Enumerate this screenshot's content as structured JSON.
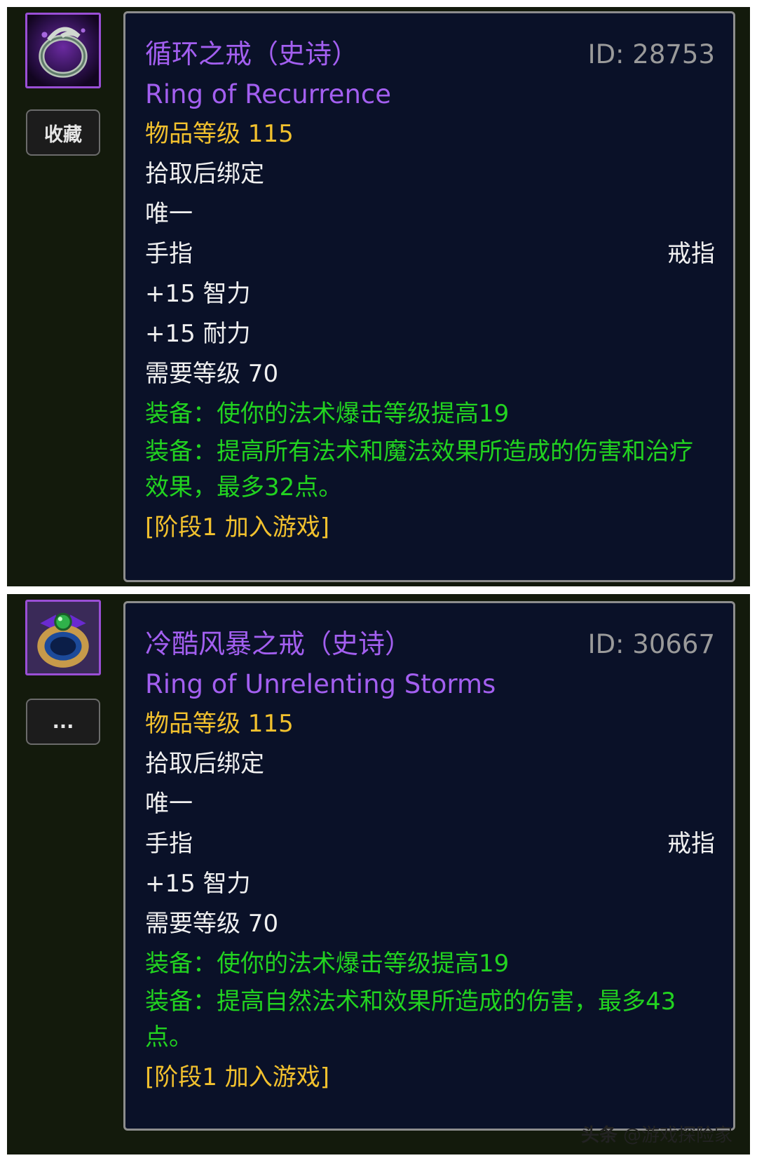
{
  "items": [
    {
      "name_cn": "循环之戒（史诗）",
      "name_en": "Ring of Recurrence",
      "id": "ID: 28753",
      "item_level": "物品等级 115",
      "bind": "拾取后绑定",
      "unique": "唯一",
      "slot": "手指",
      "type": "戒指",
      "stat1": "+15 智力",
      "stat2": "+15 耐力",
      "required_level": "需要等级 70",
      "equip1": "装备：使你的法术爆击等级提高19",
      "equip2": "装备：提高所有法术和魔法效果所造成的伤害和治疗效果，最多32点。",
      "phase": "[阶段1 加入游戏]",
      "button_label": "收藏",
      "icon": "ring-of-recurrence-icon"
    },
    {
      "name_cn": "冷酷风暴之戒（史诗）",
      "name_en": "Ring of Unrelenting Storms",
      "id": "ID: 30667",
      "item_level": "物品等级 115",
      "bind": "拾取后绑定",
      "unique": "唯一",
      "slot": "手指",
      "type": "戒指",
      "stat1": "+15 智力",
      "required_level": "需要等级 70",
      "equip1": "装备：使你的法术爆击等级提高19",
      "equip2": "装备：提高自然法术和效果所造成的伤害，最多43点。",
      "phase": "[阶段1 加入游戏]",
      "button_label": "...",
      "icon": "ring-of-unrelenting-storms-icon"
    }
  ],
  "watermark": {
    "brand": "头条",
    "handle": "@游戏探险家"
  },
  "colors": {
    "epic_purple": "#a35ff0",
    "item_level_yellow": "#f2c12e",
    "equip_green": "#22d320",
    "tooltip_bg": "#0a1128",
    "panel_bg": "#131a0c"
  }
}
